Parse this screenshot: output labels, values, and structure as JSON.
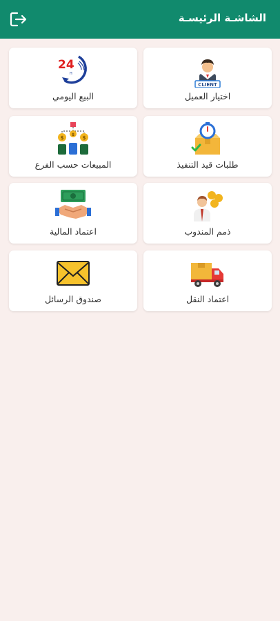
{
  "appbar": {
    "title": "الشاشـة الرئيسـة",
    "logout_icon": "logout-icon",
    "color": "#118a6d"
  },
  "menu": {
    "customer_select": {
      "label": "اختيار العميل",
      "icon": "client-icon",
      "icon_text": "CLIENT"
    },
    "daily_sales": {
      "label": "البيع اليومي",
      "icon": "24-hours-icon",
      "icon_text": "24"
    },
    "pending_orders": {
      "label": "طلبات قيد التنفيذ",
      "icon": "stopwatch-box-icon"
    },
    "sales_by_branch": {
      "label": "المبيعات حسب الفرع",
      "icon": "branch-network-icon"
    },
    "rep_accounts": {
      "label": "ذمم المندوب",
      "icon": "salesman-coins-icon"
    },
    "finance_approval": {
      "label": "اعتماد المالية",
      "icon": "handshake-money-icon"
    },
    "transport_approval": {
      "label": "اعتماد النقل",
      "icon": "delivery-truck-icon"
    },
    "inbox": {
      "label": "صندوق الرسائل",
      "icon": "envelope-icon"
    }
  },
  "background": "#f9efed"
}
